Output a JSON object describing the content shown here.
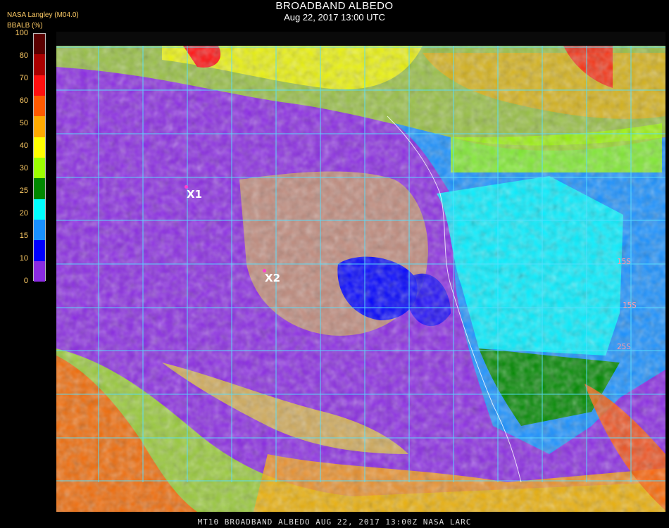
{
  "header": {
    "title": "BROADBAND ALBEDO",
    "subtitle": "Aug 22, 2017 13:00 UTC",
    "provider": "NASA Langley (M04.0)"
  },
  "colorbar": {
    "label": "BBALB (%)",
    "ticks": [
      "100",
      "80",
      "70",
      "60",
      "50",
      "40",
      "30",
      "25",
      "20",
      "15",
      "10",
      "0"
    ],
    "colors": [
      "#5a0000",
      "#aa0000",
      "#ff1010",
      "#ff5a00",
      "#ffaa00",
      "#ffff00",
      "#9cff00",
      "#008800",
      "#00ffff",
      "#1890ff",
      "#0000ff",
      "#8a2be2"
    ]
  },
  "markers": [
    {
      "label": "X1"
    },
    {
      "label": "X2"
    }
  ],
  "lat_labels": [
    "15S",
    "15S",
    "25S"
  ],
  "footer": "MT10  BROADBAND ALBEDO   AUG 22, 2017 13:00Z   NASA LARC"
}
